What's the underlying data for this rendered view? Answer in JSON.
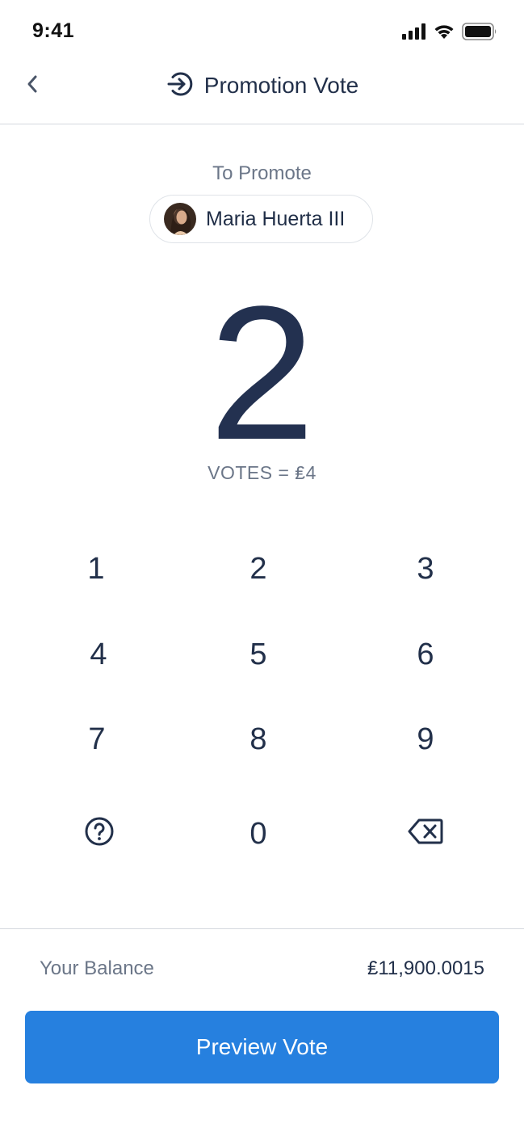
{
  "status_bar": {
    "time": "9:41",
    "icons": [
      "cellular-signal-icon",
      "wifi-icon",
      "battery-icon"
    ]
  },
  "header": {
    "title": "Promotion Vote",
    "back_icon": "chevron-left-icon",
    "title_icon": "arrow-right-circle-icon"
  },
  "promote": {
    "label": "To Promote",
    "user_name": "Maria Huerta III"
  },
  "vote": {
    "count": "2",
    "caption": "VOTES = ₤4"
  },
  "keypad": {
    "keys": [
      "1",
      "2",
      "3",
      "4",
      "5",
      "6",
      "7",
      "8",
      "9",
      "0"
    ],
    "help_icon": "question-circle-icon",
    "delete_icon": "backspace-icon"
  },
  "balance": {
    "label": "Your Balance",
    "value": "₤11,900.0015"
  },
  "action": {
    "preview_label": "Preview Vote"
  },
  "colors": {
    "primary_button": "#2680df",
    "text_dark": "#22304a",
    "text_muted": "#6b7688",
    "divider": "#d4d8de"
  }
}
